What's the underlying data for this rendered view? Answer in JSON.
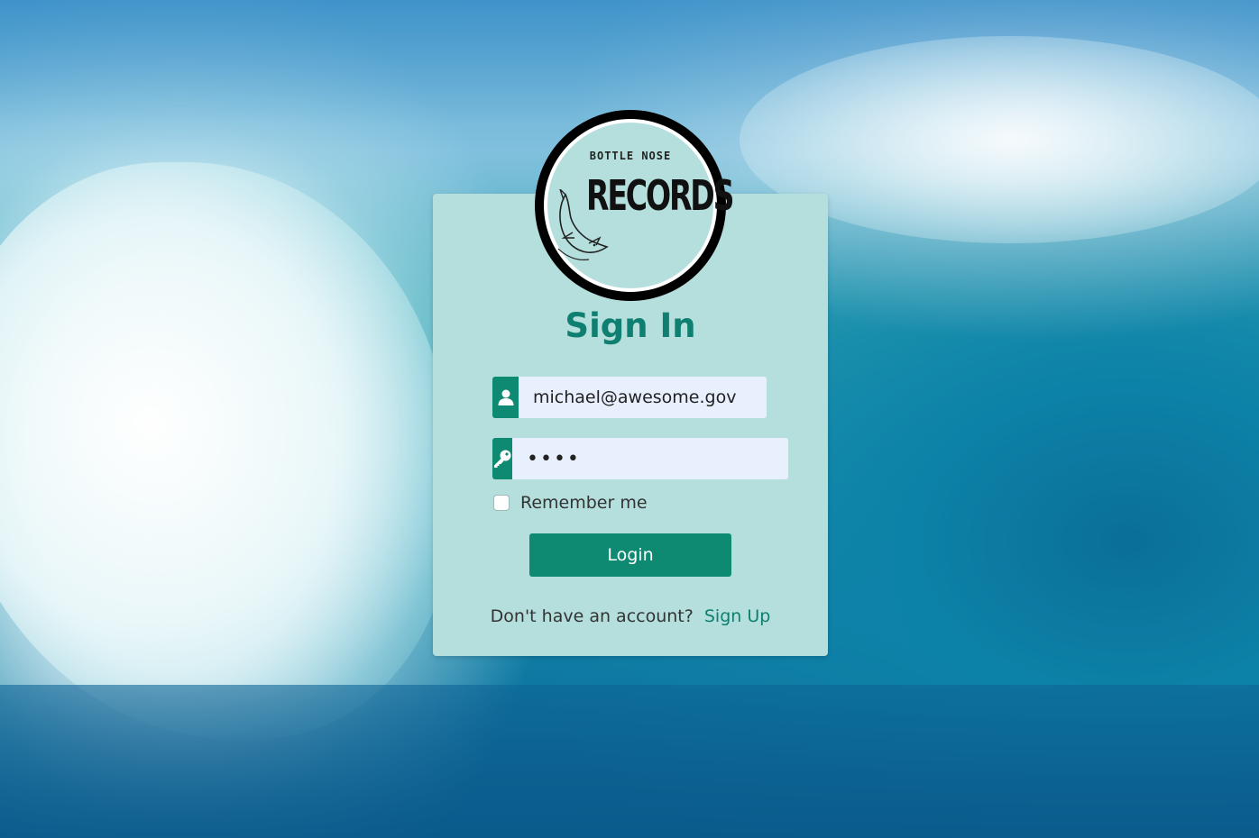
{
  "logo": {
    "top_text": "BOTTLE NOSE",
    "main_text": "RECORDS",
    "icon": "dolphin-icon"
  },
  "form": {
    "title": "Sign In",
    "email": {
      "icon": "user-icon",
      "value": "michael@awesome.gov"
    },
    "password": {
      "icon": "key-icon",
      "value": "••••"
    },
    "remember_label": "Remember me",
    "remember_checked": false,
    "login_label": "Login",
    "signup_prompt": "Don't have an account?",
    "signup_link": "Sign Up"
  },
  "colors": {
    "accent": "#0f8a72",
    "card": "#b4dfdc",
    "title": "#0e7f70",
    "input_bg": "#e8f0fe"
  }
}
